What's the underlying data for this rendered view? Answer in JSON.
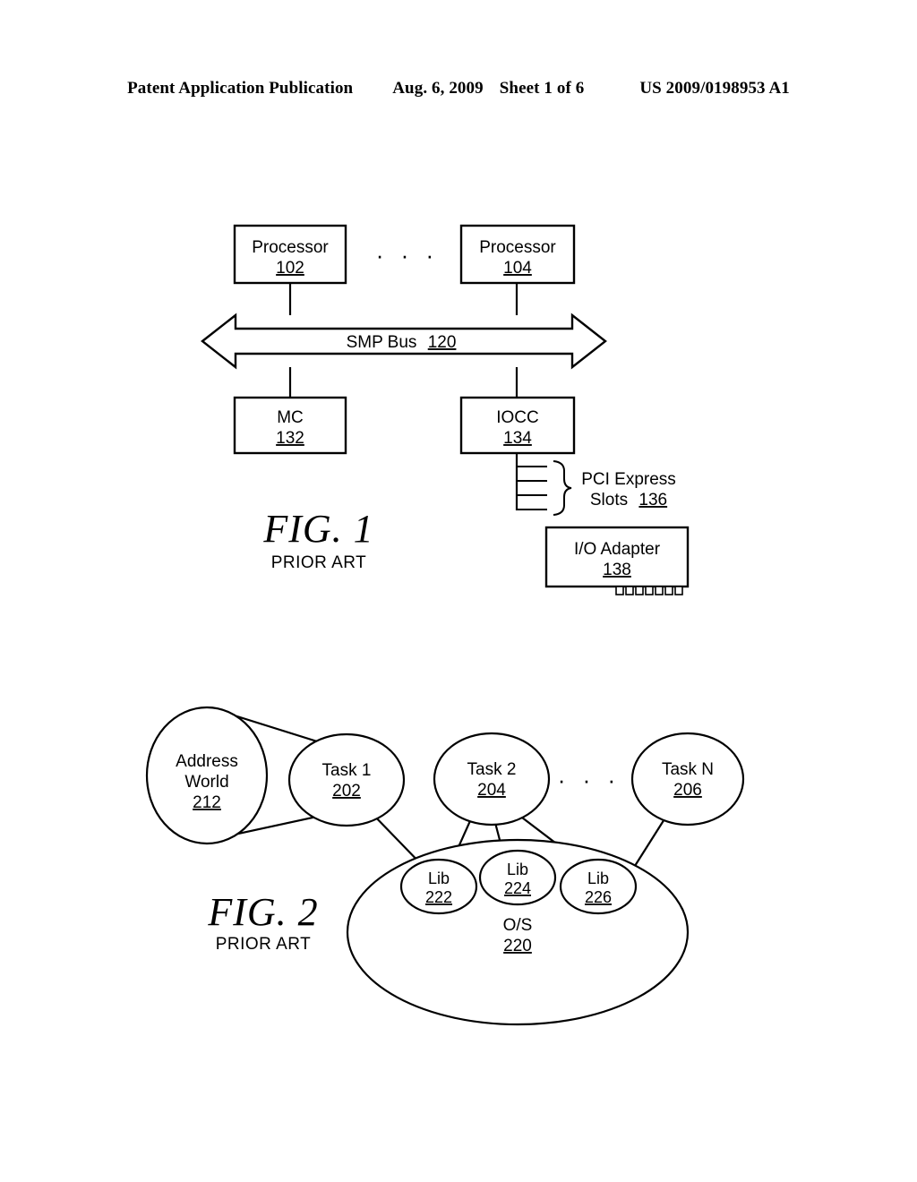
{
  "header": {
    "publication": "Patent Application Publication",
    "date": "Aug. 6, 2009",
    "sheet": "Sheet 1 of 6",
    "number": "US 2009/0198953 A1"
  },
  "figure1": {
    "title": "FIG. 1",
    "subtitle": "PRIOR ART",
    "ellipsis": "· · ·",
    "nodes": {
      "processor_left": {
        "label": "Processor",
        "ref": "102"
      },
      "processor_right": {
        "label": "Processor",
        "ref": "104"
      },
      "bus": {
        "label": "SMP Bus",
        "ref": "120"
      },
      "memory_controller": {
        "label": "MC",
        "ref": "132"
      },
      "iocc": {
        "label": "IOCC",
        "ref": "134"
      },
      "pci_slots": {
        "label_line1": "PCI Express",
        "label_line2": "Slots",
        "ref": "136",
        "slot_count": 4
      },
      "io_adapter": {
        "label": "I/O Adapter",
        "ref": "138",
        "tooth_count": 7
      }
    }
  },
  "figure2": {
    "title": "FIG. 2",
    "subtitle": "PRIOR ART",
    "ellipsis": "· · ·",
    "nodes": {
      "address_world": {
        "label_line1": "Address",
        "label_line2": "World",
        "ref": "212"
      },
      "task_1": {
        "label": "Task 1",
        "ref": "202"
      },
      "task_2": {
        "label": "Task 2",
        "ref": "204"
      },
      "task_n": {
        "label": "Task N",
        "ref": "206"
      },
      "lib_222": {
        "label": "Lib",
        "ref": "222"
      },
      "lib_224": {
        "label": "Lib",
        "ref": "224"
      },
      "lib_226": {
        "label": "Lib",
        "ref": "226"
      },
      "os": {
        "label": "O/S",
        "ref": "220"
      }
    }
  },
  "colors": {
    "ink": "#000000",
    "paper": "#ffffff"
  }
}
